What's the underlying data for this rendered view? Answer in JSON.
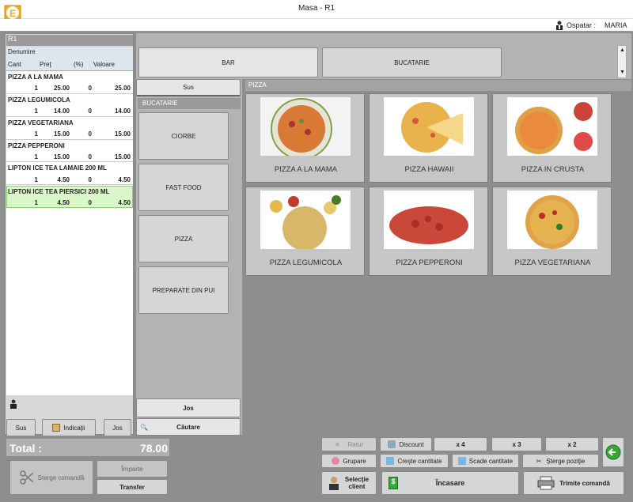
{
  "window": {
    "title": "Masa - R1"
  },
  "topbar": {
    "waiter_label": "Ospatar :",
    "waiter_name": "MARIA"
  },
  "order": {
    "table": "R1",
    "headers": {
      "name": "Denumire",
      "qty": "Cant",
      "price": "Preţ",
      "pct": "(%)",
      "value": "Valoare"
    },
    "items": [
      {
        "name": "PIZZA A LA MAMA",
        "qty": "1",
        "price": "25.00",
        "pct": "0",
        "value": "25.00"
      },
      {
        "name": "PIZZA LEGUMICOLA",
        "qty": "1",
        "price": "14.00",
        "pct": "0",
        "value": "14.00"
      },
      {
        "name": "PIZZA VEGETARIANA",
        "qty": "1",
        "price": "15.00",
        "pct": "0",
        "value": "15.00"
      },
      {
        "name": "PIZZA PEPPERONI",
        "qty": "1",
        "price": "15.00",
        "pct": "0",
        "value": "15.00"
      },
      {
        "name": "LIPTON ICE TEA LAMAIE 200 ML",
        "qty": "1",
        "price": "4.50",
        "pct": "0",
        "value": "4.50"
      },
      {
        "name": "LIPTON ICE TEA PIERSICI 200 ML",
        "qty": "1",
        "price": "4.50",
        "pct": "0",
        "value": "4.50"
      }
    ],
    "buttons": {
      "up": "Sus",
      "notes": "Indicaţii",
      "down": "Jos"
    },
    "total_label": "Total :",
    "total_value": "78.00",
    "actions": {
      "delete_order": "Sterge comandă",
      "split": "Împarte",
      "transfer": "Transfer"
    }
  },
  "categories": {
    "up": "Sus",
    "header": "BUCATARIE",
    "items": [
      "CIORBE",
      "FAST FOOD",
      "PIZZA",
      "PREPARATE DIN PUI"
    ],
    "down": "Jos",
    "search": "Căutare"
  },
  "sections": [
    "BAR",
    "BUCATARIE"
  ],
  "products": {
    "header": "PIZZA",
    "items": [
      "PIZZA A LA MAMA",
      "PIZZA HAWAII",
      "PIZZA IN CRUSTA",
      "PIZZA LEGUMICOLA",
      "PIZZA PEPPERONI",
      "PIZZA VEGETARIANA"
    ]
  },
  "actions": {
    "return": "Retur",
    "discount": "Discount",
    "x4": "x 4",
    "x3": "x 3",
    "x2": "x 2",
    "group": "Grupare",
    "increase": "Creşte cantitate",
    "decrease": "Scade cantitate",
    "delete_pos": "Şterge poziţie",
    "select_client": "Selecţie client",
    "checkout": "Încasare",
    "send_order": "Trimite comandă"
  },
  "colors": {
    "selected_row": "#d9f7c9",
    "accent_green": "#3aa63a"
  }
}
